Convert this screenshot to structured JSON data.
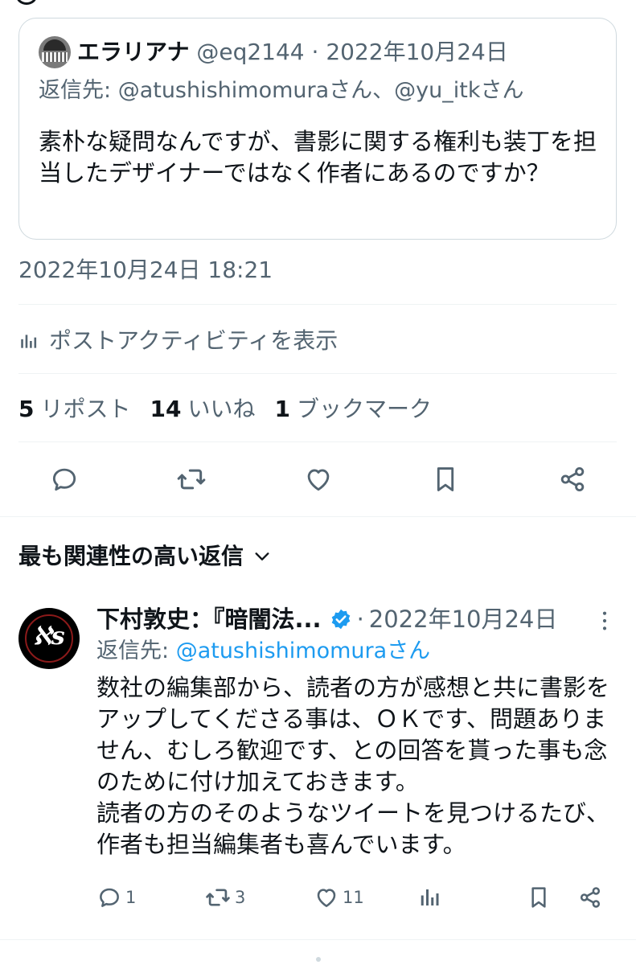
{
  "quote": {
    "display_name": "エラリアナ",
    "handle": "@eq2144",
    "separator": "·",
    "date": "2022年10月24日",
    "reply_prefix": "返信先: ",
    "reply_targets": "@atushishimomuraさん、@yu_itkさん",
    "body": "素朴な疑問なんですが、書影に関する権利も装丁を担当したデザイナーではなく作者にあるのですか？"
  },
  "tweet": {
    "timestamp": "2022年10月24日 18:21",
    "activity_label": "ポストアクティビティを表示",
    "stats": [
      {
        "count": "5",
        "label": "リポスト"
      },
      {
        "count": "14",
        "label": "いいね"
      },
      {
        "count": "1",
        "label": "ブックマーク"
      }
    ],
    "actions": [
      "reply-icon",
      "retweet-icon",
      "like-icon",
      "bookmark-icon",
      "share-icon"
    ]
  },
  "replies_section": {
    "title": "最も関連性の高い返信"
  },
  "reply": {
    "display_name": "下村敦史：『暗闇法...",
    "separator": "·",
    "date": "2022年10月24日",
    "reply_prefix": "返信先: ",
    "reply_target": "@atushishimomuraさん",
    "body_line1": "数社の編集部から、読者の方が感想と共に書影をアップしてくださる事は、ＯＫです、問題ありません、むしろ歓迎です、との回答を貰った事も念のために付け加えておきます。",
    "body_line2": "読者の方のそのようなツイートを見つけるたび、作者も担当編集者も喜んでいます。",
    "counts": {
      "replies": "1",
      "retweets": "3",
      "likes": "11"
    },
    "brand_color": "#1d9bf0"
  }
}
